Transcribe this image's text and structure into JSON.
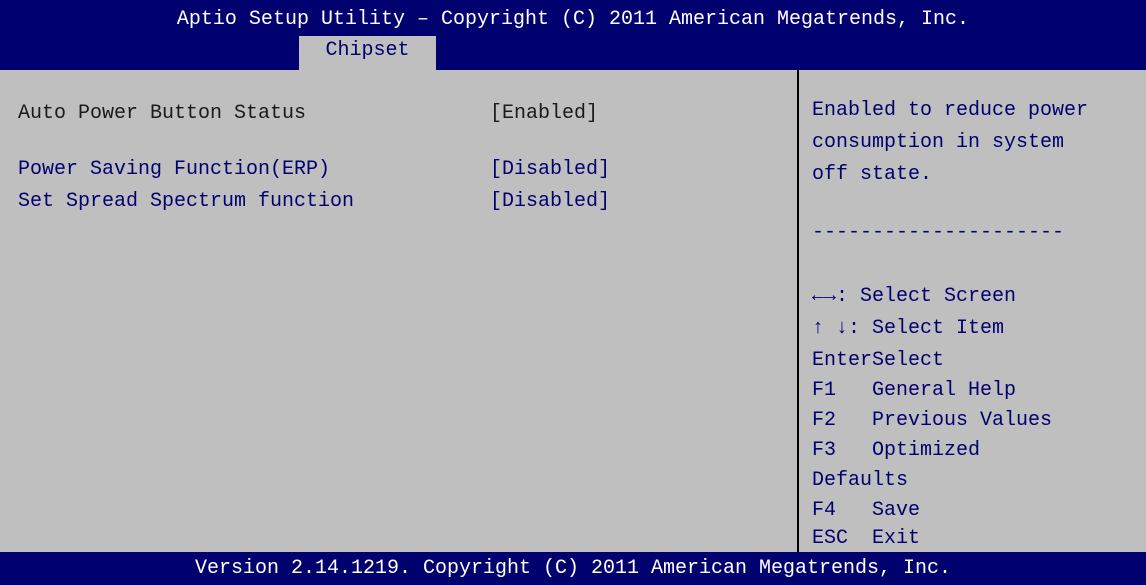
{
  "header": {
    "title": "Aptio Setup Utility – Copyright (C) 2011 American Megatrends, Inc.",
    "active_tab": "Chipset"
  },
  "settings": [
    {
      "label": "Auto Power Button Status",
      "value": "[Enabled]",
      "style": "static"
    },
    {
      "label": "Power Saving Function(ERP)",
      "value": "[Disabled]",
      "style": "link"
    },
    {
      "label": "Set Spread Spectrum function",
      "value": "[Disabled]",
      "style": "link"
    }
  ],
  "help": {
    "lines": [
      "Enabled to reduce power",
      "consumption in system",
      "off state."
    ],
    "separator": "---------------------"
  },
  "keys": [
    "←→: Select Screen",
    "↑ ↓: Select Item",
    "EnterSelect",
    "F1   General Help",
    "F2   Previous Values",
    "F3   Optimized",
    "Defaults",
    "F4   Save",
    "ESC  Exit"
  ],
  "footer": {
    "text": "Version 2.14.1219. Copyright (C) 2011 American Megatrends, Inc."
  },
  "colors": {
    "header_bg": "#00006e",
    "body_bg": "#bfbfbf",
    "link_text": "#00006e",
    "static_text": "#1a1a1a"
  }
}
